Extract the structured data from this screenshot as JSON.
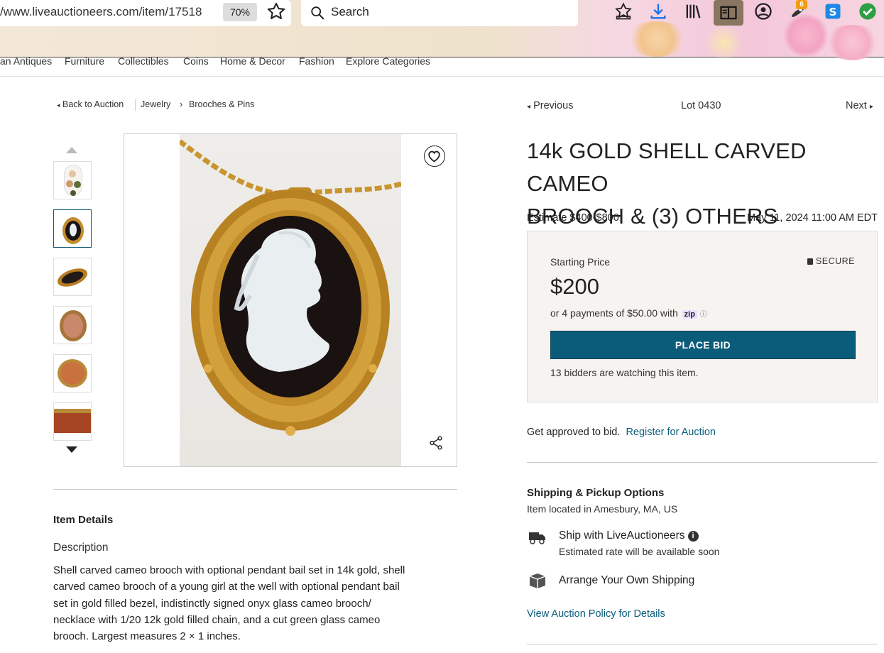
{
  "browser": {
    "url": "/www.liveauctioneers.com/item/17518",
    "zoom": "70%",
    "search_placeholder": "Search",
    "extension_badge": "6"
  },
  "category_nav": [
    "an Antiques",
    "Furniture",
    "Collectibles",
    "Coins",
    "Home & Decor",
    "Fashion",
    "Explore Categories"
  ],
  "breadcrumb": {
    "back": "Back to Auction",
    "items": [
      "Jewelry",
      "Brooches & Pins"
    ]
  },
  "lot_nav": {
    "previous": "Previous",
    "lot": "Lot 0430",
    "next": "Next"
  },
  "item": {
    "title_line1": "14k GOLD SHELL CARVED CAMEO",
    "title_line2": "BROOCH & (3) OTHERS",
    "estimate": "Estimate $400-$800",
    "date": "May 11, 2024 11:00 AM EDT"
  },
  "bid": {
    "starting_label": "Starting Price",
    "secure_label": "SECURE",
    "price": "$200",
    "payments": "or 4 payments of $50.00 with",
    "zip_label": "zip",
    "button": "PLACE BID",
    "watching": "13 bidders are watching this item."
  },
  "register": {
    "text": "Get approved to bid.",
    "link": "Register for Auction"
  },
  "shipping": {
    "heading": "Shipping & Pickup Options",
    "location": "Item located in Amesbury, MA, US",
    "option1_title": "Ship with LiveAuctioneers",
    "option1_sub": "Estimated rate will be available soon",
    "option2_title": "Arrange Your Own Shipping",
    "policy_link": "View Auction Policy for Details"
  },
  "details": {
    "heading": "Item Details",
    "desc_heading": "Description",
    "description_lines": [
      "Shell carved cameo brooch with optional pendant bail set in 14k gold, shell",
      "carved cameo brooch of a young girl at the well with optional pendant bail",
      "set in gold filled bezel, indistinctly signed onyx glass cameo brooch/",
      "necklace with 1/20 12k gold filled chain, and a cut green glass cameo",
      "brooch. Largest measures 2 × 1 inches."
    ]
  },
  "colors": {
    "accent": "#0b5c7a",
    "bid_box_bg": "#f7f3f1"
  }
}
